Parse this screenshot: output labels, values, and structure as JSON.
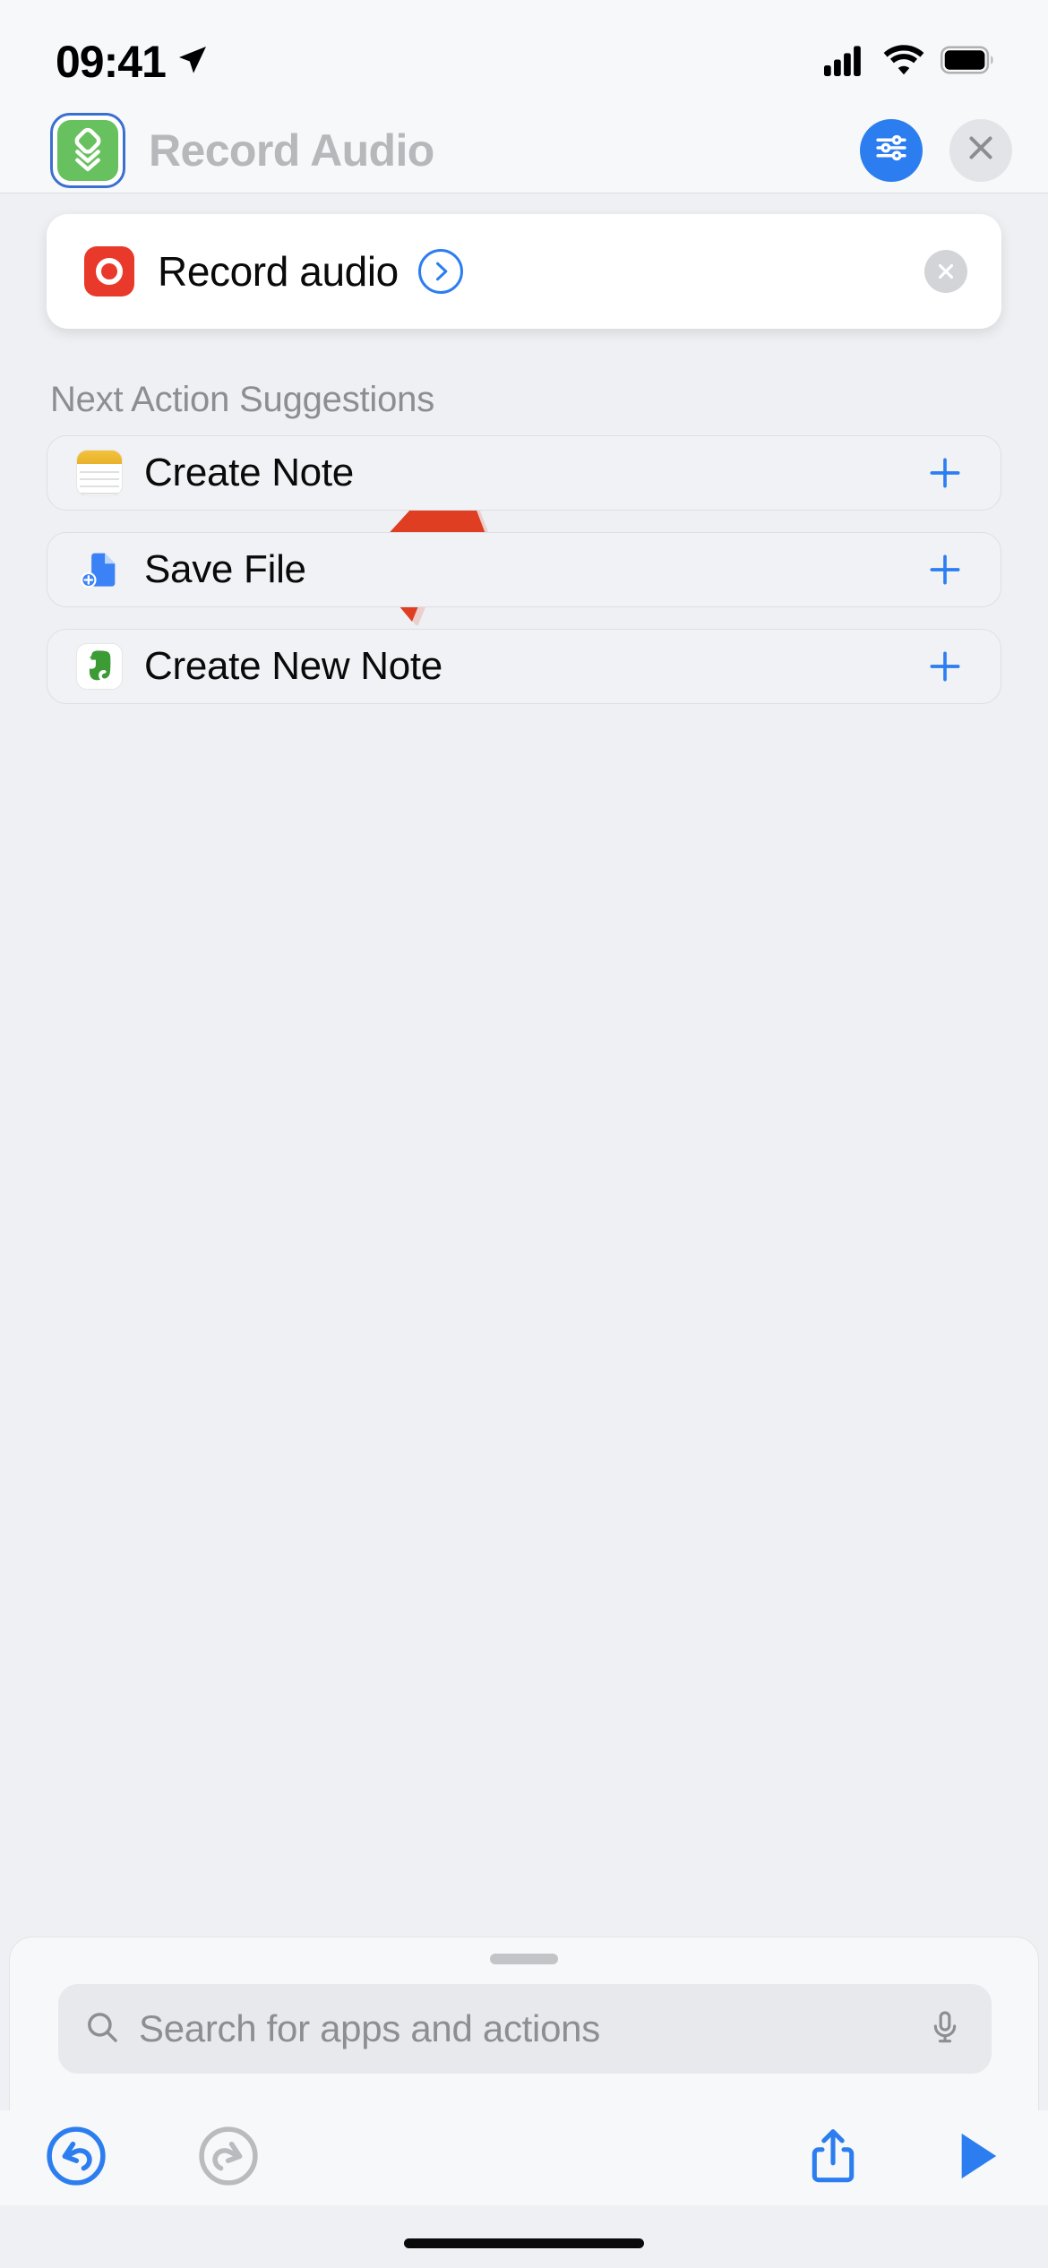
{
  "status_bar": {
    "time": "09:41",
    "location_icon": "location-arrow-icon",
    "cellular_icon": "cellular-bars-icon",
    "wifi_icon": "wifi-icon",
    "battery_icon": "battery-full-icon"
  },
  "header": {
    "shortcut_icon": "shortcuts-layers-icon",
    "title": "Record Audio",
    "settings_button": "sliders-icon",
    "close_button": "close-x-icon",
    "accent_blue": "#2c7ef0",
    "icon_green": "#68c15f",
    "title_color": "#b6b8bb"
  },
  "action_card": {
    "icon": "record-audio-icon",
    "icon_color": "#e8392b",
    "label": "Record audio",
    "expand_button": "chevron-right-circle-icon",
    "delete_button": "close-x-circle-icon"
  },
  "annotation": {
    "arrow": "red-pointer-arrow",
    "color": "#e03e22"
  },
  "suggestions": {
    "section_label": "Next Action Suggestions",
    "items": [
      {
        "label": "Create Note",
        "icon": "apple-notes-icon",
        "add_button": "plus-icon"
      },
      {
        "label": "Save File",
        "icon": "save-file-icon",
        "add_button": "plus-icon"
      },
      {
        "label": "Create New Note",
        "icon": "evernote-icon",
        "add_button": "plus-icon"
      }
    ]
  },
  "sheet": {
    "grabber": "drag-handle",
    "search": {
      "icon": "search-icon",
      "placeholder": "Search for apps and actions",
      "mic_icon": "microphone-icon"
    }
  },
  "toolbar": {
    "undo": "undo-icon",
    "redo": "redo-icon",
    "share": "share-icon",
    "play": "play-icon",
    "undo_color": "#2c7ef0",
    "redo_color": "#b9bbbe",
    "play_color": "#2c7ef0"
  },
  "home_indicator": "home-indicator"
}
